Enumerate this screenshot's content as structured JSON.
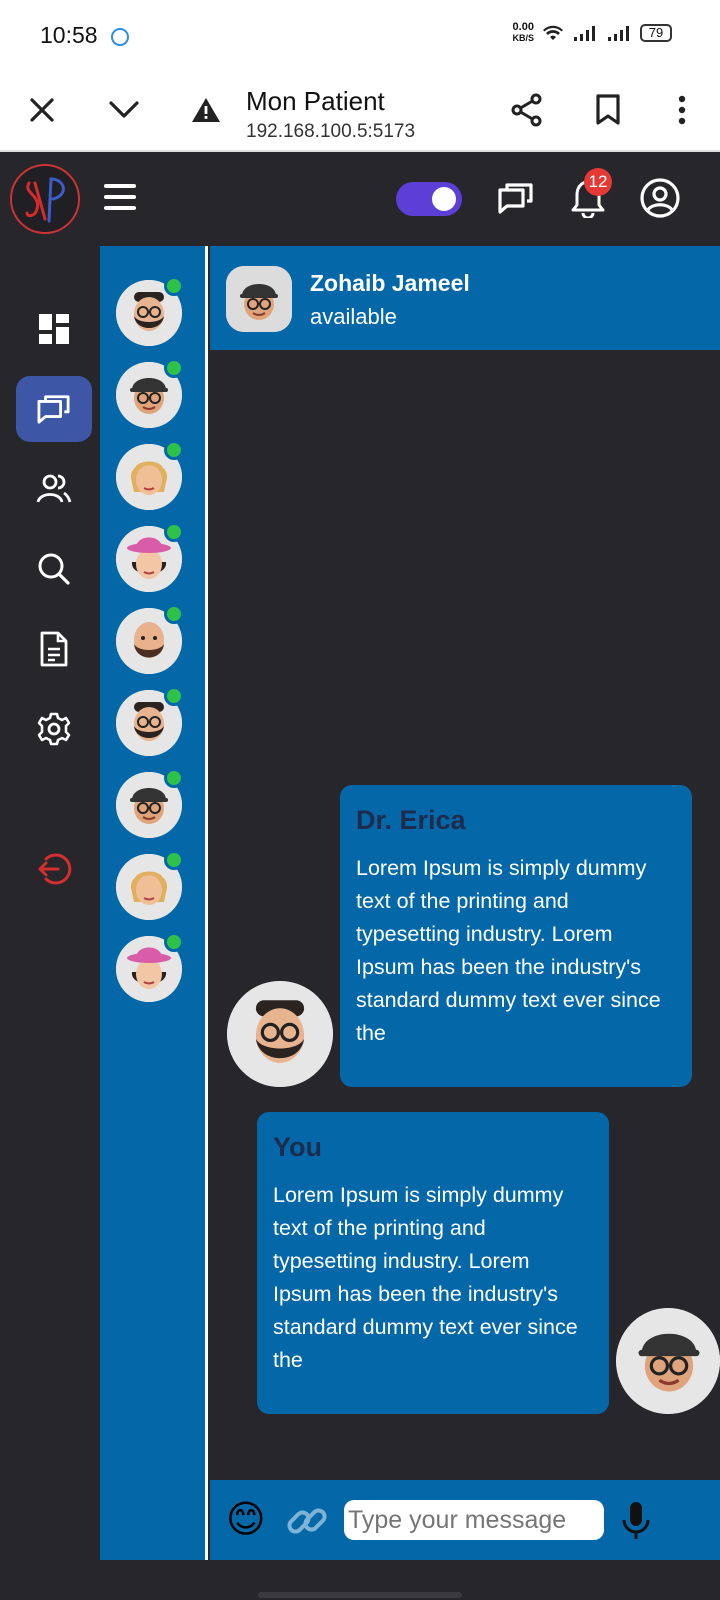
{
  "status_bar": {
    "time": "10:58",
    "net_speed_top": "0.00",
    "net_speed_bottom": "KB/S",
    "battery": "79"
  },
  "browser": {
    "title": "Mon Patient",
    "url": "192.168.100.5:5173"
  },
  "header": {
    "notification_count": "12"
  },
  "sidebar": {
    "items": [
      {
        "name": "dashboard",
        "icon": "dashboard-icon"
      },
      {
        "name": "chat",
        "icon": "chat-icon",
        "active": true
      },
      {
        "name": "users",
        "icon": "users-icon"
      },
      {
        "name": "search",
        "icon": "search-icon"
      },
      {
        "name": "documents",
        "icon": "document-icon"
      },
      {
        "name": "settings",
        "icon": "gear-icon"
      },
      {
        "name": "logout",
        "icon": "logout-icon"
      }
    ]
  },
  "colors": {
    "accent": "#0468a8",
    "online": "#2fc24a",
    "toggle": "#5b3fd6",
    "badge": "#e53935",
    "logout": "#d32f2f"
  },
  "chat": {
    "contact_name": "Zohaib Jameel",
    "contact_status": "available",
    "messages": [
      {
        "sender": "Dr. Erica",
        "text": "Lorem Ipsum is simply dummy text of the printing and typesetting industry. Lorem Ipsum has been the industry's standard dummy text ever since the"
      },
      {
        "sender": "You",
        "text": "Lorem Ipsum is simply dummy text of the printing and typesetting industry. Lorem Ipsum has been the industry's standard dummy text ever since the"
      }
    ]
  },
  "composer": {
    "placeholder": "Type your message",
    "emoji": "😊"
  }
}
